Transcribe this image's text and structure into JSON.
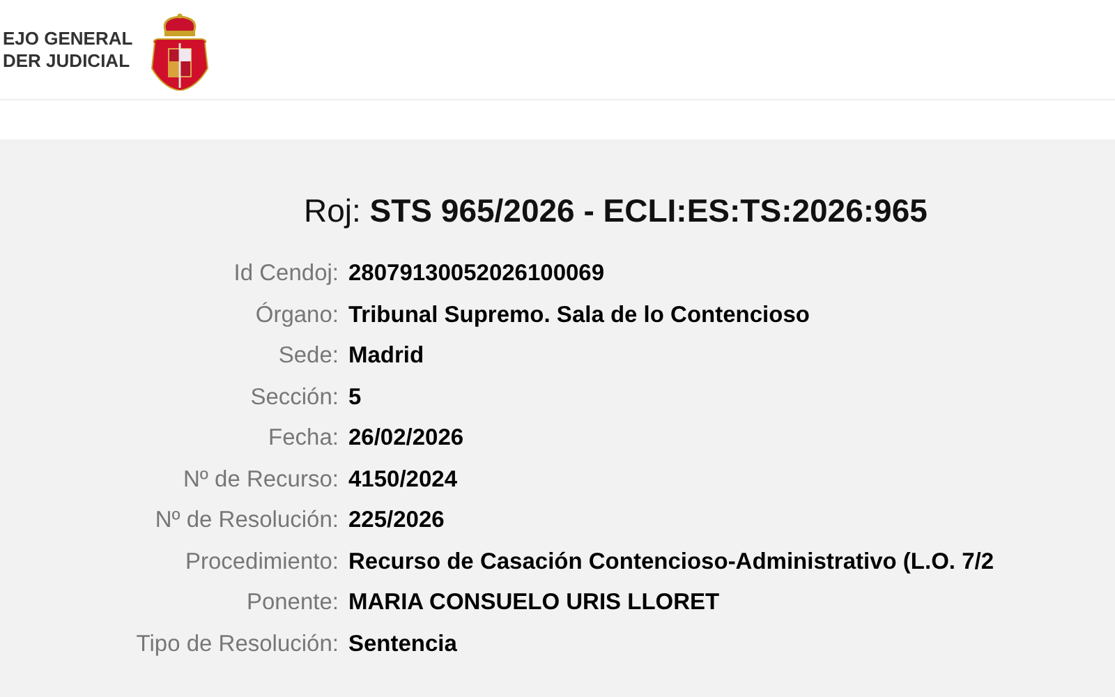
{
  "header": {
    "logo_lines": [
      "EJO GENERAL",
      "DER JUDICIAL"
    ]
  },
  "document": {
    "title": "Roj: **STS 965/2026 - ECLI:ES:TS:2026:965**",
    "fields": [
      {
        "label": "Id Cendoj:",
        "value": "28079130052026100069"
      },
      {
        "label": "Órgano:",
        "value": "Tribunal Supremo. Sala de lo Contencioso"
      },
      {
        "label": "Sede:",
        "value": "Madrid"
      },
      {
        "label": "Sección:",
        "value": "5"
      },
      {
        "label": "Fecha:",
        "value": "26/02/2026"
      },
      {
        "label": "Nº de Recurso:",
        "value": "4150/2024"
      },
      {
        "label": "Nº de Resolución:",
        "value": "225/2026"
      },
      {
        "label": "Procedimiento:",
        "value": "Recurso de Casación Contencioso-Administrativo (L.O. 7/2"
      },
      {
        "label": "Ponente:",
        "value": "MARIA CONSUELO URIS LLORET"
      },
      {
        "label": "Tipo de Resolución:",
        "value": "Sentencia"
      }
    ]
  }
}
